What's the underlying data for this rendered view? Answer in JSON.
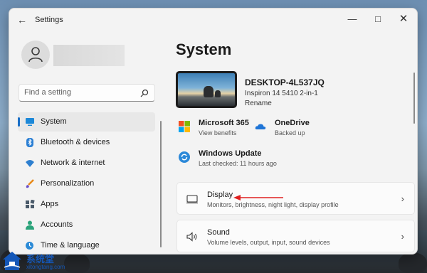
{
  "window": {
    "title": "Settings",
    "back_icon": "back-arrow-icon",
    "controls": {
      "minimize_icon": "minimize-icon",
      "maximize_icon": "maximize-icon",
      "close_icon": "close-icon"
    }
  },
  "user": {
    "avatar_icon": "user-avatar-icon"
  },
  "search": {
    "placeholder": "Find a setting",
    "icon": "search-icon"
  },
  "sidebar": {
    "items": [
      {
        "label": "System",
        "icon": "system-monitor-icon",
        "active": true
      },
      {
        "label": "Bluetooth & devices",
        "icon": "bluetooth-icon",
        "active": false
      },
      {
        "label": "Network & internet",
        "icon": "wifi-icon",
        "active": false
      },
      {
        "label": "Personalization",
        "icon": "paintbrush-icon",
        "active": false
      },
      {
        "label": "Apps",
        "icon": "apps-icon",
        "active": false
      },
      {
        "label": "Accounts",
        "icon": "account-icon",
        "active": false
      },
      {
        "label": "Time & language",
        "icon": "globe-clock-icon",
        "active": false
      }
    ]
  },
  "main": {
    "title": "System",
    "device": {
      "name": "DESKTOP-4L537JQ",
      "model": "Inspiron 14 5410 2-in-1",
      "rename_label": "Rename"
    },
    "quick_status": [
      {
        "title": "Microsoft 365",
        "subtitle": "View benefits",
        "icon": "microsoft-365-icon"
      },
      {
        "title": "OneDrive",
        "subtitle": "Backed up",
        "icon": "onedrive-cloud-icon"
      },
      {
        "title": "Windows Update",
        "subtitle": "Last checked: 11 hours ago",
        "icon": "windows-update-icon"
      }
    ],
    "cards": [
      {
        "title": "Display",
        "subtitle": "Monitors, brightness, night light, display profile",
        "icon": "display-icon"
      },
      {
        "title": "Sound",
        "subtitle": "Volume levels, output, input, sound devices",
        "icon": "speaker-icon"
      }
    ]
  },
  "annotation": {
    "arrow_color": "#e02020"
  },
  "watermark": {
    "title": "系统堂",
    "url": "xitongtang.com"
  },
  "colors": {
    "accent": "#1a6fc7",
    "window_bg": "#f3f3f3"
  }
}
